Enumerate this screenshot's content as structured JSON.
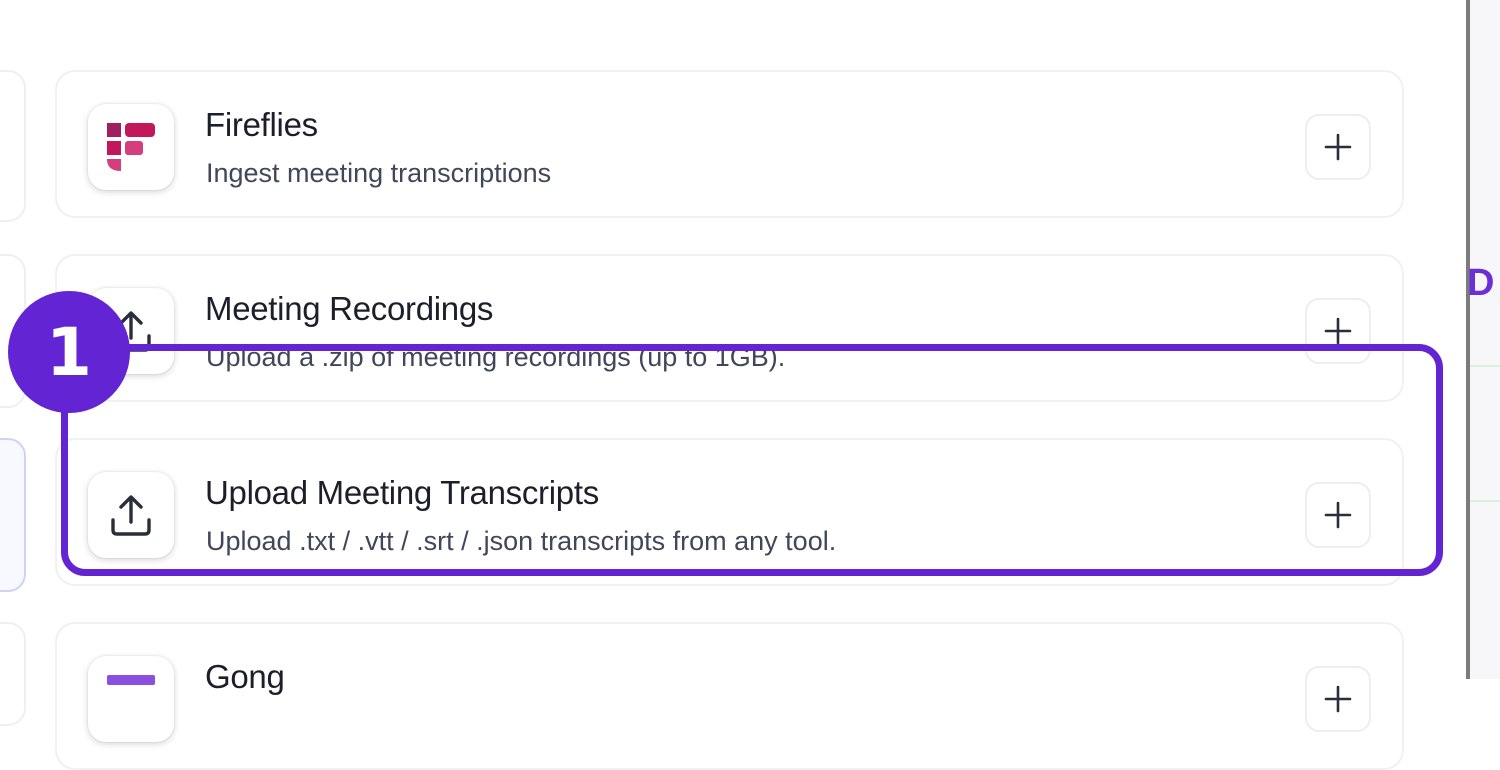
{
  "integrations": [
    {
      "title": "Fireflies",
      "description": "Ingest meeting transcriptions",
      "icon": "fireflies-logo",
      "action_label": "+"
    },
    {
      "title": "Meeting Recordings",
      "description": "Upload a .zip of meeting recordings (up to 1GB).",
      "icon": "upload-icon",
      "action_label": "+"
    },
    {
      "title": "Upload Meeting Transcripts",
      "description": "Upload .txt / .vtt / .srt / .json transcripts from any tool.",
      "icon": "upload-icon",
      "action_label": "+"
    },
    {
      "title": "Gong",
      "description": "",
      "icon": "gong-logo",
      "action_label": "+"
    }
  ],
  "annotation": {
    "step_number": "1",
    "color": "#6324d4"
  },
  "side_panel": {
    "peek_text": "D"
  },
  "colors": {
    "fireflies_brand": "#c2185b",
    "gong_brand": "#8a4fe0",
    "highlight": "#6324d4"
  }
}
